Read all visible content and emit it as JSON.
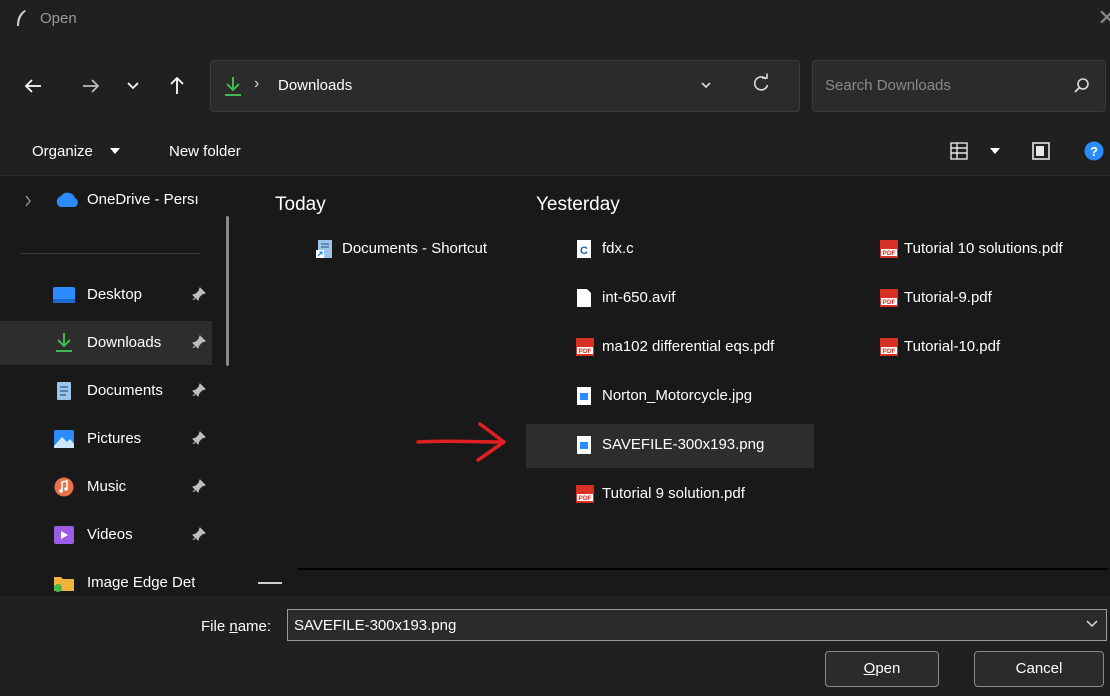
{
  "window": {
    "title": "Open"
  },
  "address": {
    "crumb": "Downloads",
    "separator": "›"
  },
  "search": {
    "placeholder": "Search Downloads"
  },
  "toolbar": {
    "organize": "Organize",
    "new_folder": "New folder"
  },
  "sidebar": {
    "top": {
      "label": "OneDrive - Persı"
    },
    "items": [
      {
        "label": "Desktop",
        "icon": "desktop-icon"
      },
      {
        "label": "Downloads",
        "icon": "download-icon"
      },
      {
        "label": "Documents",
        "icon": "documents-icon"
      },
      {
        "label": "Pictures",
        "icon": "pictures-icon"
      },
      {
        "label": "Music",
        "icon": "music-icon"
      },
      {
        "label": "Videos",
        "icon": "videos-icon"
      },
      {
        "label": "Image Edge Det",
        "icon": "folder-icon"
      }
    ]
  },
  "content": {
    "groups": {
      "today": "Today",
      "yesterday": "Yesterday"
    },
    "today_files": [
      {
        "name": "Documents - Shortcut",
        "icon": "shortcut-icon"
      }
    ],
    "yesterday_col1": [
      {
        "name": "fdx.c",
        "icon": "c-file-icon"
      },
      {
        "name": "int-650.avif",
        "icon": "file-icon"
      },
      {
        "name": "ma102 differential eqs.pdf",
        "icon": "pdf-icon"
      },
      {
        "name": "Norton_Motorcycle.jpg",
        "icon": "image-icon"
      },
      {
        "name": "SAVEFILE-300x193.png",
        "icon": "image-icon"
      },
      {
        "name": "Tutorial 9 solution.pdf",
        "icon": "pdf-icon"
      }
    ],
    "yesterday_col2": [
      {
        "name": "Tutorial 10 solutions.pdf",
        "icon": "pdf-icon"
      },
      {
        "name": "Tutorial-9.pdf",
        "icon": "pdf-icon"
      },
      {
        "name": "Tutorial-10.pdf",
        "icon": "pdf-icon"
      }
    ]
  },
  "bottom": {
    "filename_label_pre": "File ",
    "filename_label_u": "n",
    "filename_label_post": "ame:",
    "filename_value": "SAVEFILE-300x193.png",
    "open_u": "O",
    "open_rest": "pen",
    "cancel": "Cancel"
  },
  "colors": {
    "accent": "#4cc2ff",
    "download_green": "#3fb950",
    "annotation": "#e02020"
  }
}
